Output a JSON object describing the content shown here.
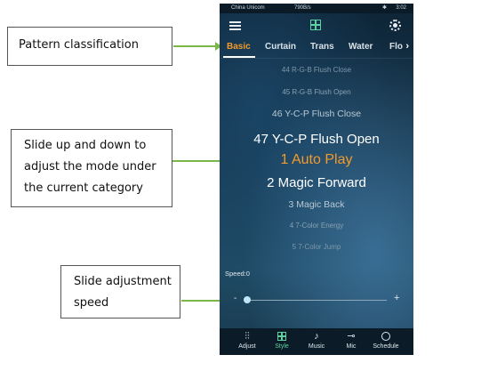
{
  "callouts": {
    "pattern": [
      "Pattern classification"
    ],
    "slide_mode": [
      "Slide up and down to",
      "adjust the mode under",
      "the current category"
    ],
    "slide_speed": [
      "Slide adjustment",
      "speed"
    ]
  },
  "status_bar": {
    "carrier": "China Unicom",
    "speed": "790B/s",
    "time": "3:02"
  },
  "tabs": [
    {
      "label": "Basic",
      "active": true
    },
    {
      "label": "Curtain",
      "active": false
    },
    {
      "label": "Trans",
      "active": false
    },
    {
      "label": "Water",
      "active": false
    },
    {
      "label": "Flo",
      "active": false
    }
  ],
  "modes": [
    "44 R-G-B Flush Close",
    "45 R-G-B Flush Open",
    "46 Y-C-P Flush Close",
    "47 Y-C-P Flush Open",
    "1 Auto Play",
    "2 Magic Forward",
    "3 Magic Back",
    "4 7-Color Energy",
    "5 7-Color Jump"
  ],
  "selected_mode": "1 Auto Play",
  "speed": {
    "label": "Speed:0",
    "value": 0,
    "minus": "-",
    "plus": "+"
  },
  "bottom_nav": [
    {
      "label": "Adjust",
      "icon": "sliders-icon",
      "active": false
    },
    {
      "label": "Style",
      "icon": "grid-icon",
      "active": true
    },
    {
      "label": "Music",
      "icon": "music-icon",
      "active": false
    },
    {
      "label": "Mic",
      "icon": "mic-icon",
      "active": false
    },
    {
      "label": "Schedule",
      "icon": "clock-icon",
      "active": false
    }
  ],
  "colors": {
    "accent_orange": "#f39a2b",
    "accent_green": "#5fd0a0",
    "arrow_green": "#7ab648"
  }
}
